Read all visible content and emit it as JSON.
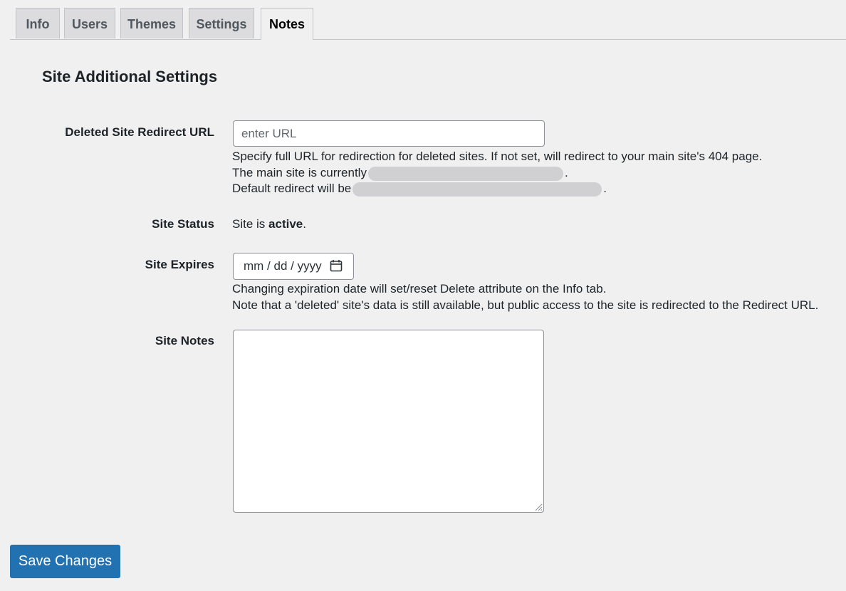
{
  "tabs": [
    {
      "label": "Info"
    },
    {
      "label": "Users"
    },
    {
      "label": "Themes"
    },
    {
      "label": "Settings"
    },
    {
      "label": "Notes",
      "active": true
    }
  ],
  "heading": "Site Additional Settings",
  "redirect": {
    "label": "Deleted Site Redirect URL",
    "placeholder": "enter URL",
    "help_line1": "Specify full URL for redirection for deleted sites. If not set, will redirect to your main site's 404 page.",
    "help_line2_prefix": "The main site is currently",
    "help_line2_suffix": ".",
    "help_line3_prefix": "Default redirect will be",
    "help_line3_suffix": "."
  },
  "status": {
    "label": "Site Status",
    "prefix": "Site is ",
    "value": "active",
    "suffix": "."
  },
  "expires": {
    "label": "Site Expires",
    "placeholder": "mm / dd / yyyy",
    "help_line1": "Changing expiration date will set/reset Delete attribute on the Info tab.",
    "help_line2": "Note that a 'deleted' site's data is still available, but public access to the site is redirected to the Redirect URL.",
    "icon": "calendar-icon"
  },
  "notes": {
    "label": "Site Notes",
    "value": ""
  },
  "save_button": "Save Changes",
  "colors": {
    "primary": "#2271b1",
    "background": "#f0f0f1",
    "tab_inactive": "#dcdcde"
  }
}
